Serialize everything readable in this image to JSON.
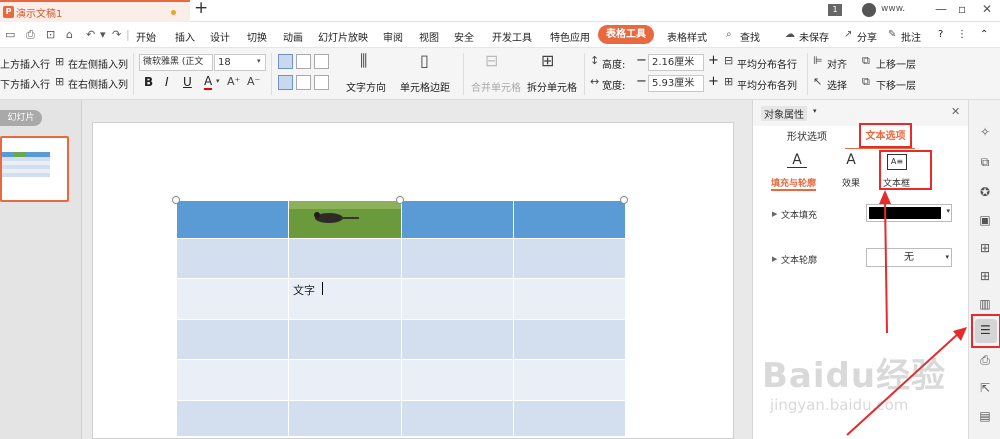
{
  "app": {
    "doc_name": "演示文稿1",
    "page_badge": "1",
    "user": "www."
  },
  "window": {
    "min": "—",
    "max": "▫",
    "close": "✕"
  },
  "menu": {
    "items": [
      "开始",
      "插入",
      "设计",
      "切换",
      "动画",
      "幻灯片放映",
      "审阅",
      "视图",
      "安全",
      "开发工具",
      "特色应用"
    ],
    "active": "表格工具",
    "after_active": "表格样式",
    "search": "查找",
    "save_state": "未保存",
    "share": "分享",
    "annotate": "批注",
    "help": "?"
  },
  "ribbon": {
    "insert_above": "上方插入行",
    "insert_below": "下方插入行",
    "insert_left": "在左侧插入列",
    "insert_right": "在右侧插入列",
    "font_name": "微软雅黑 (正文",
    "font_size": "18",
    "bold": "B",
    "italic": "I",
    "underline": "U",
    "font_color": "A",
    "text_direction": "文字方向",
    "cell_margin": "单元格边距",
    "merge_cells": "合并单元格",
    "split_cells": "拆分单元格",
    "height_label": "高度:",
    "height_value": "2.16厘米",
    "width_label": "宽度:",
    "width_value": "5.93厘米",
    "distribute_rows": "平均分布各行",
    "distribute_cols": "平均分布各列",
    "align": "对齐",
    "select": "选择",
    "bring_forward": "上移一层",
    "send_backward": "下移一层",
    "minus": "−",
    "plus": "+"
  },
  "left_panel": {
    "slides_tab": "幻灯片"
  },
  "slide": {
    "cell_text": "文字"
  },
  "panel": {
    "title": "对象属性",
    "close": "✕",
    "tab_shape": "形状选项",
    "tab_text": "文本选项",
    "sub_fill": "填充与轮廓",
    "sub_effect": "效果",
    "sub_textbox": "文本框",
    "fill_label": "文本填充",
    "outline_label": "文本轮廓",
    "outline_value": "无",
    "fill_color": "#000000",
    "accent": "#e8693e"
  },
  "watermark": {
    "main": "Baidu经验",
    "sub": "jingyan.baidu.com"
  },
  "colors": {
    "header_row": "#5b9bd5",
    "row_dark": "#d3deee",
    "row_light": "#eaeff7",
    "highlight": "#e52b2b"
  }
}
